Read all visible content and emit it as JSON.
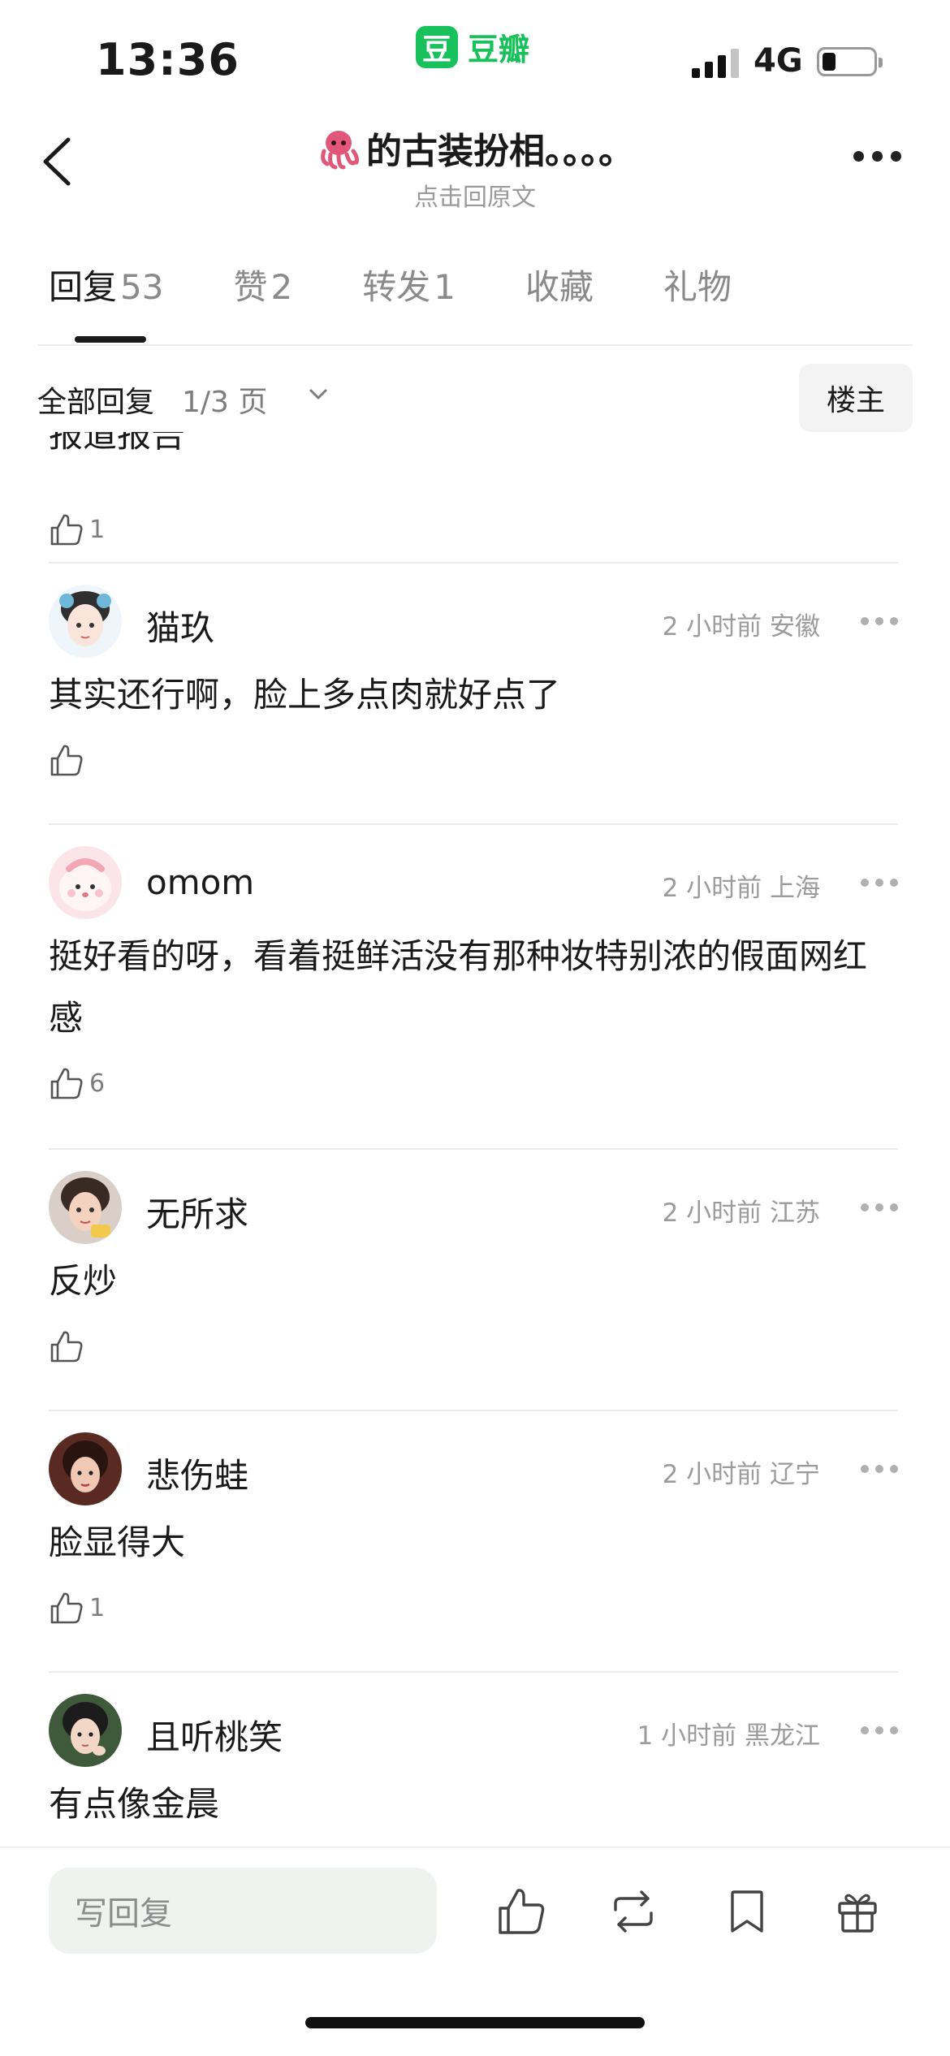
{
  "status_bar": {
    "time": "13:36",
    "app_name": "豆瓣",
    "app_logo_char": "豆",
    "network": "4G"
  },
  "nav": {
    "title": "的古装扮相。。。。",
    "subtitle": "点击回原文",
    "title_icon": "octopus-emoji",
    "back_icon": "chevron-left-icon",
    "more_icon": "more-horizontal-icon"
  },
  "tabs": [
    {
      "label": "回复",
      "count": "53",
      "active": true
    },
    {
      "label": "赞",
      "count": "2"
    },
    {
      "label": "转发",
      "count": "1"
    },
    {
      "label": "收藏",
      "count": ""
    },
    {
      "label": "礼物",
      "count": ""
    }
  ],
  "filter": {
    "label": "全部回复",
    "page": "1/3 页",
    "op_button": "楼主"
  },
  "partial_comment": {
    "text": "报道报告",
    "likes": "1"
  },
  "comments": [
    {
      "name": "猫玖",
      "time": "2 小时前",
      "location": "安徽",
      "text": "其实还行啊，脸上多点肉就好点了",
      "likes": ""
    },
    {
      "name": "omom",
      "time": "2 小时前",
      "location": "上海",
      "text": "挺好看的呀，看着挺鲜活没有那种妆特别浓的假面网红感",
      "likes": "6"
    },
    {
      "name": "无所求",
      "time": "2 小时前",
      "location": "江苏",
      "text": "反炒",
      "likes": ""
    },
    {
      "name": "悲伤蛙",
      "time": "2 小时前",
      "location": "辽宁",
      "text": "脸显得大",
      "likes": "1"
    },
    {
      "name": "且听桃笑",
      "time": "1 小时前",
      "location": "黑龙江",
      "text": "有点像金晨",
      "likes": ""
    }
  ],
  "bottom_bar": {
    "reply_placeholder": "写回复",
    "icons": [
      "thumbs-up-icon",
      "repost-icon",
      "bookmark-icon",
      "gift-icon"
    ]
  },
  "colors": {
    "brand_green": "#19c15c",
    "text_primary": "#1a1a1a",
    "text_secondary": "#9b9b9b",
    "divider": "#ececec"
  }
}
